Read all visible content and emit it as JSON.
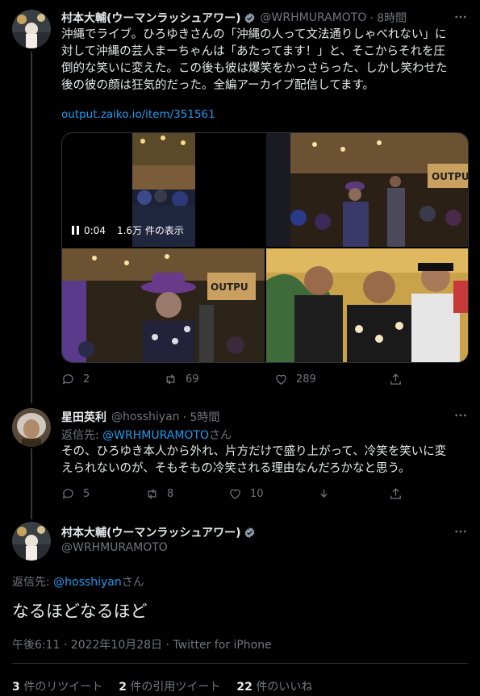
{
  "tweet1": {
    "name": "村本大輔(ウーマンラッシュアワー)",
    "handle": "@WRHMURAMOTO",
    "time": "· 8時間",
    "lines": [
      "沖縄でライブ。ひろゆきさんの「沖縄の人って文法通りしゃべれない」に",
      "対して沖縄の芸人まーちゃんは「あたってます！」と、そこからそれを圧",
      "倒的な笑いに変えた。この後も彼は爆笑をかっさらった、しかし笑わせた",
      "後の彼の顔は狂気的だった。全編アーカイブ配信してます。"
    ],
    "link": "output.zaiko.io/item/351561",
    "video_time": "0:04",
    "video_views": "1.6万 件の表示",
    "replies": "2",
    "retweets": "69",
    "likes": "289"
  },
  "tweet2": {
    "name": "星田英利",
    "handle": "@hosshiyan",
    "time": "· 5時間",
    "reply_prefix": "返信先: ",
    "reply_handle": "@WRHMURAMOTO",
    "reply_suffix": "さん",
    "lines": [
      "その、ひろゆき本人から外れ、片方だけで盛り上がって、冷笑を笑いに変",
      "えられないのが、そもそもの冷笑される理由なんだろかなと思う。"
    ],
    "replies": "5",
    "retweets": "8",
    "likes": "10"
  },
  "tweet3": {
    "name": "村本大輔(ウーマンラッシュアワー)",
    "handle": "@WRHMURAMOTO",
    "reply_prefix": "返信先: ",
    "reply_handle": "@hosshiyan",
    "reply_suffix": "さん",
    "text": "なるほどなるほど",
    "meta": "午後6:11 · 2022年10月28日 · Twitter for iPhone",
    "stats": {
      "retweets_count": "3",
      "retweets_label": " 件のリツイート",
      "quotes_count": "2",
      "quotes_label": " 件の引用ツイート",
      "likes_count": "22",
      "likes_label": " 件のいいね"
    }
  },
  "colors": {
    "background": "#000000",
    "text": "#e7e9ea",
    "muted": "#71767b",
    "link": "#1d9bf0",
    "verified": "#8b98a5"
  }
}
